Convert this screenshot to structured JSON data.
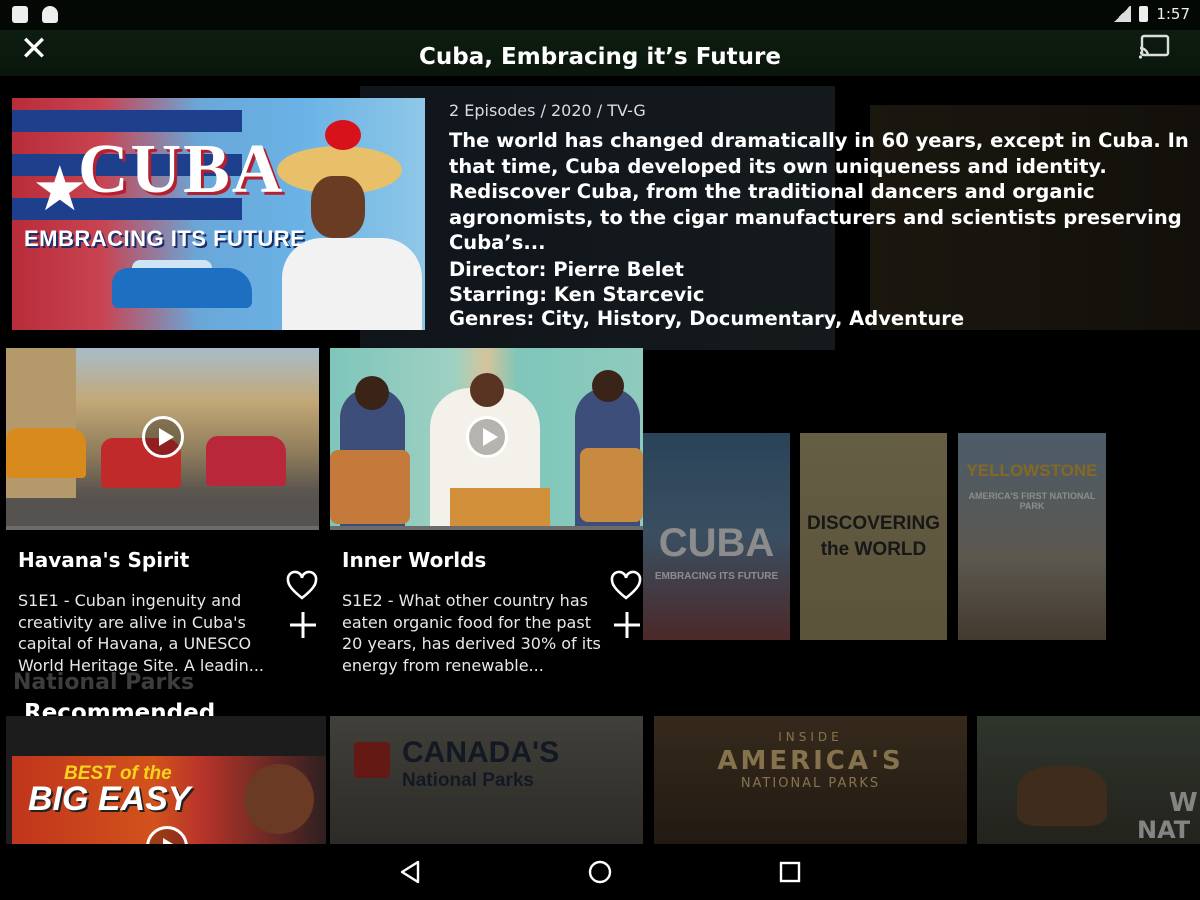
{
  "status_bar": {
    "time": "1:57"
  },
  "header": {
    "title": "Cuba, Embracing it’s Future"
  },
  "show": {
    "meta": "2 Episodes / 2020 / TV-G",
    "description": "The world has changed dramatically in 60 years, except in Cuba. In that time, Cuba developed its own uniqueness and identity. Rediscover Cuba, from the traditional dancers and organic agronomists, to the cigar manufacturers and scientists preserving Cuba’s...",
    "director": "Director: Pierre Belet",
    "starring": "Starring: Ken Starcevic",
    "genres": "Genres: City, History, Documentary, Adventure",
    "poster_title": "CUBA",
    "poster_subtitle": "EMBRACING ITS FUTURE"
  },
  "episodes": [
    {
      "title": "Havana's Spirit",
      "description": "S1E1 - Cuban ingenuity and creativity are alive in Cuba's capital of Havana, a UNESCO World Heritage Site. A leadin..."
    },
    {
      "title": "Inner Worlds",
      "description": "S1E2 - What other country has eaten organic food for the past 20 years, has derived 30% of its energy from renewable..."
    }
  ],
  "background_posters": {
    "cuba": "CUBA",
    "cuba_sub": "EMBRACING ITS FUTURE",
    "discovering": "DISCOVERING the WORLD",
    "yellowstone": "YELLOWSTONE",
    "yellowstone_sub": "AMERICA'S FIRST NATIONAL PARK"
  },
  "recommended": {
    "heading": "Recommended",
    "faded_label": "National Parks",
    "cards": [
      {
        "line1": "BEST of the",
        "line2": "BIG EASY"
      },
      {
        "line1": "CANADA'S",
        "line2": "National Parks"
      },
      {
        "line1": "INSIDE",
        "line2": "AMERICA'S",
        "line3": "NATIONAL PARKS"
      },
      {
        "line1": "W",
        "line2": "NAT"
      }
    ]
  },
  "colors": {
    "top_bar": "#0d1d10",
    "background": "#000000",
    "progress_bar": "#6b6b6b"
  },
  "icons": [
    "close-icon",
    "cast-icon",
    "play-icon",
    "heart-icon",
    "plus-icon",
    "back-icon",
    "home-icon",
    "recents-icon"
  ]
}
